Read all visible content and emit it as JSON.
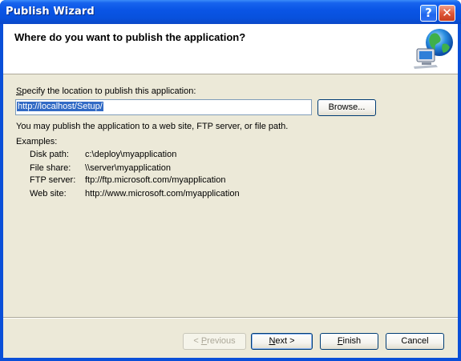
{
  "window": {
    "title": "Publish Wizard",
    "help_glyph": "?",
    "close_glyph": "✕"
  },
  "header": {
    "title": "Where do you want to publish the application?",
    "icon": "globe-network-icon"
  },
  "location": {
    "label_prefix": "S",
    "label_rest": "pecify the location to publish this application:",
    "value": "http://localhost/Setup/",
    "browse_label": "Browse..."
  },
  "info": {
    "hint": "You may publish the application to a web site, FTP server, or file path.",
    "examples_title": "Examples:",
    "examples": [
      {
        "label": "Disk path:",
        "value": "c:\\deploy\\myapplication"
      },
      {
        "label": "File share:",
        "value": "\\\\server\\myapplication"
      },
      {
        "label": "FTP server:",
        "value": "ftp://ftp.microsoft.com/myapplication"
      },
      {
        "label": "Web site:",
        "value": "http://www.microsoft.com/myapplication"
      }
    ]
  },
  "buttons": {
    "previous_prefix": "< ",
    "previous_mnemonic": "P",
    "previous_rest": "revious",
    "next_mnemonic": "N",
    "next_rest": "ext >",
    "finish_mnemonic": "F",
    "finish_rest": "inish",
    "cancel": "Cancel"
  },
  "colors": {
    "title_bar": "#0a55e6",
    "dialog_bg": "#ece9d8",
    "selection": "#316ac5"
  }
}
